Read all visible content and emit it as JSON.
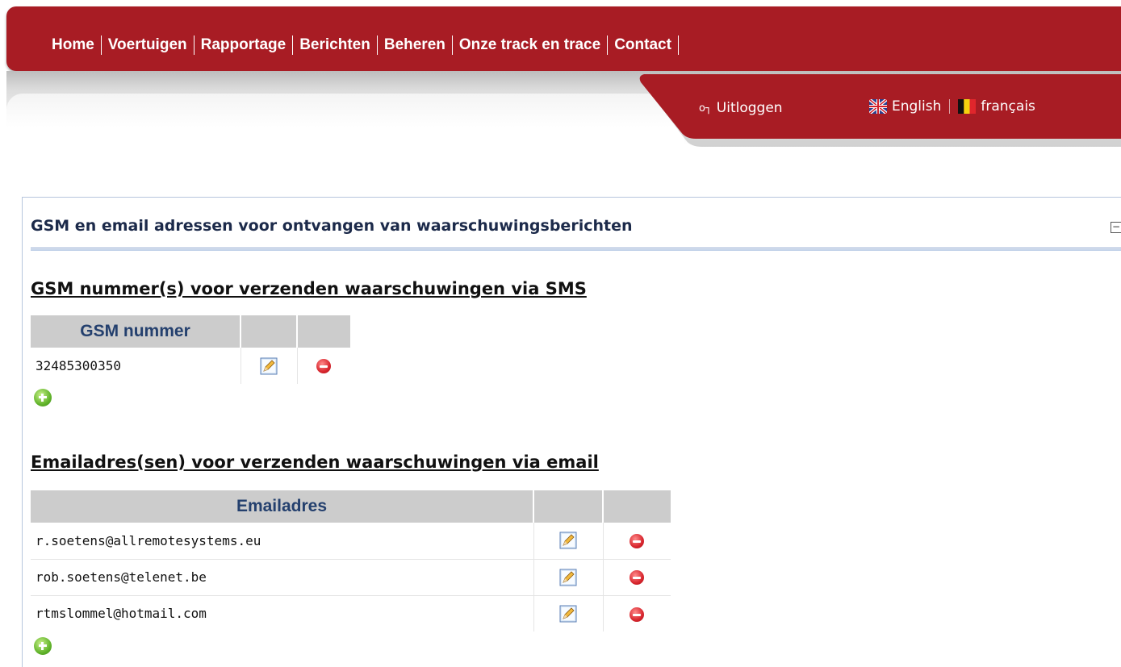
{
  "nav": {
    "items": [
      "Home",
      "Voertuigen",
      "Rapportage",
      "Berichten",
      "Beheren",
      "Onze track en trace",
      "Contact"
    ]
  },
  "account": {
    "logout_label": "Uitloggen",
    "languages": [
      "English",
      "français"
    ]
  },
  "panel": {
    "title": "GSM en email adressen voor ontvangen van waarschuwingsberichten",
    "collapse_label": "−"
  },
  "sms": {
    "title": "GSM nummer(s) voor verzenden waarschuwingen via SMS",
    "column_header": "GSM nummer",
    "rows": [
      "32485300350"
    ]
  },
  "email": {
    "title": "Emailadres(sen) voor verzenden waarschuwingen via email",
    "column_header": "Emailadres",
    "rows": [
      "r.soetens@allremotesystems.eu",
      "rob.soetens@telenet.be",
      "rtmslommel@hotmail.com"
    ]
  },
  "colors": {
    "brand_red": "#a81c24",
    "header_grey": "#cccccc",
    "header_text": "#24406e"
  },
  "icons": [
    "edit-icon",
    "delete-icon",
    "add-icon",
    "uk-flag-icon",
    "belgium-flag-icon",
    "key-icon"
  ]
}
